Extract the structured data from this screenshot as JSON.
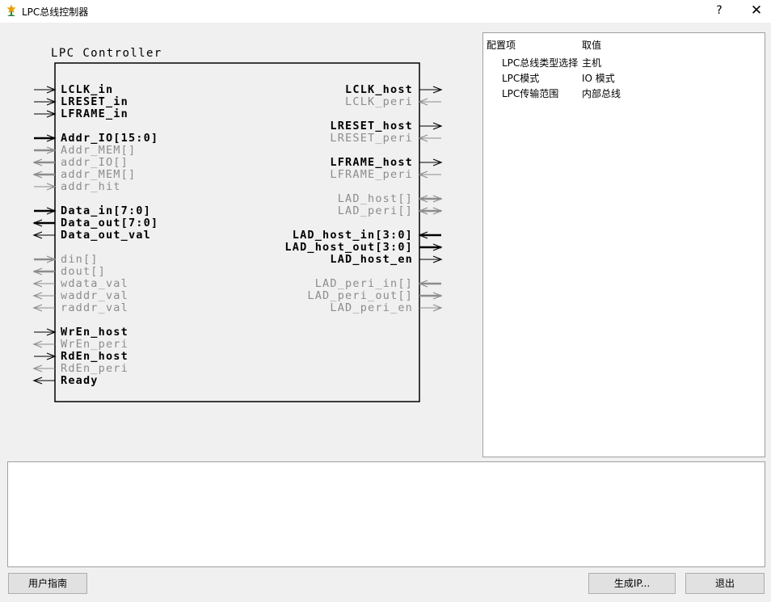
{
  "window": {
    "title": "LPC总线控制器",
    "help_label": "?",
    "close_label": "✕"
  },
  "block": {
    "title": "LPC Controller"
  },
  "colors": {
    "active": "#000000",
    "inactive": "#8c8c8c"
  },
  "left_ports": [
    {
      "label": "LCLK_in",
      "dir": "in",
      "bus": false,
      "active": true
    },
    {
      "label": "LRESET_in",
      "dir": "in",
      "bus": false,
      "active": true
    },
    {
      "label": "LFRAME_in",
      "dir": "in",
      "bus": false,
      "active": true
    },
    null,
    {
      "label": "Addr_IO[15:0]",
      "dir": "in",
      "bus": true,
      "active": true
    },
    {
      "label": "Addr_MEM[]",
      "dir": "in",
      "bus": true,
      "active": false
    },
    {
      "label": "addr_IO[]",
      "dir": "out",
      "bus": true,
      "active": false
    },
    {
      "label": "addr_MEM[]",
      "dir": "out",
      "bus": true,
      "active": false
    },
    {
      "label": "addr_hit",
      "dir": "in",
      "bus": false,
      "active": false
    },
    null,
    {
      "label": "Data_in[7:0]",
      "dir": "in",
      "bus": true,
      "active": true
    },
    {
      "label": "Data_out[7:0]",
      "dir": "out",
      "bus": true,
      "active": true
    },
    {
      "label": "Data_out_val",
      "dir": "out",
      "bus": false,
      "active": true
    },
    null,
    {
      "label": "din[]",
      "dir": "in",
      "bus": true,
      "active": false
    },
    {
      "label": "dout[]",
      "dir": "out",
      "bus": true,
      "active": false
    },
    {
      "label": "wdata_val",
      "dir": "out",
      "bus": false,
      "active": false
    },
    {
      "label": "waddr_val",
      "dir": "out",
      "bus": false,
      "active": false
    },
    {
      "label": "raddr_val",
      "dir": "out",
      "bus": false,
      "active": false
    },
    null,
    {
      "label": "WrEn_host",
      "dir": "in",
      "bus": false,
      "active": true
    },
    {
      "label": "WrEn_peri",
      "dir": "out",
      "bus": false,
      "active": false
    },
    {
      "label": "RdEn_host",
      "dir": "in",
      "bus": false,
      "active": true
    },
    {
      "label": "RdEn_peri",
      "dir": "out",
      "bus": false,
      "active": false
    },
    {
      "label": "Ready",
      "dir": "out",
      "bus": false,
      "active": true
    }
  ],
  "right_ports": [
    {
      "label": "LCLK_host",
      "dir": "out",
      "bus": false,
      "active": true
    },
    {
      "label": "LCLK_peri",
      "dir": "in",
      "bus": false,
      "active": false
    },
    null,
    {
      "label": "LRESET_host",
      "dir": "out",
      "bus": false,
      "active": true
    },
    {
      "label": "LRESET_peri",
      "dir": "in",
      "bus": false,
      "active": false
    },
    null,
    {
      "label": "LFRAME_host",
      "dir": "out",
      "bus": false,
      "active": true
    },
    {
      "label": "LFRAME_peri",
      "dir": "in",
      "bus": false,
      "active": false
    },
    null,
    {
      "label": "LAD_host[]",
      "dir": "bi",
      "bus": true,
      "active": false
    },
    {
      "label": "LAD_peri[]",
      "dir": "bi",
      "bus": true,
      "active": false
    },
    null,
    {
      "label": "LAD_host_in[3:0]",
      "dir": "in",
      "bus": true,
      "active": true
    },
    {
      "label": "LAD_host_out[3:0]",
      "dir": "out",
      "bus": true,
      "active": true
    },
    {
      "label": "LAD_host_en",
      "dir": "out",
      "bus": false,
      "active": true
    },
    null,
    {
      "label": "LAD_peri_in[]",
      "dir": "in",
      "bus": true,
      "active": false
    },
    {
      "label": "LAD_peri_out[]",
      "dir": "out",
      "bus": true,
      "active": false
    },
    {
      "label": "LAD_peri_en",
      "dir": "out",
      "bus": false,
      "active": false
    }
  ],
  "properties": {
    "header_key": "配置项",
    "header_value": "取值",
    "rows": [
      {
        "key": "LPC总线类型选择",
        "value": "主机"
      },
      {
        "key": "LPC模式",
        "value": "IO 模式"
      },
      {
        "key": "LPC传输范围",
        "value": "内部总线"
      }
    ]
  },
  "log": {
    "text": ""
  },
  "buttons": {
    "user_guide": "用户指南",
    "generate_ip": "生成IP...",
    "exit": "退出"
  }
}
